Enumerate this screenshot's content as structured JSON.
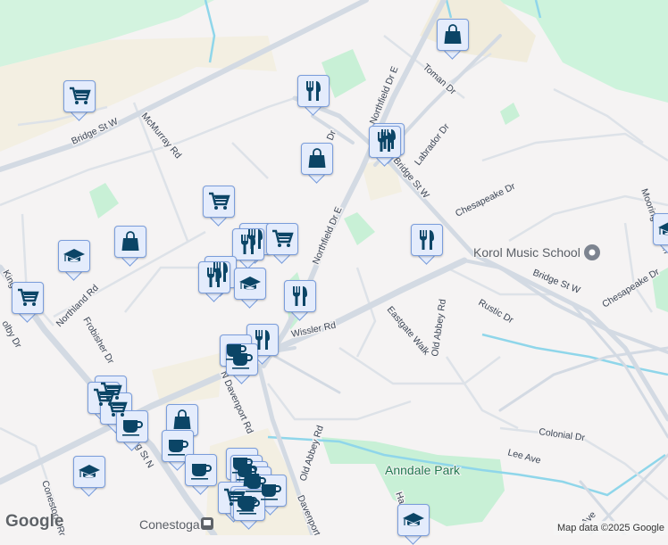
{
  "map": {
    "roads": {
      "bridge_st_w_west": "Bridge St W",
      "bridge_st_w_north": "Bridge St W",
      "bridge_st_w_east": "Bridge St W",
      "northfield_dr_e_north": "Northfield Dr E",
      "northfield_dr_e_south": "Northfield Dr E",
      "toman_dr": "Toman Dr",
      "labrador_dr": "Labrador Dr",
      "chesapeake_dr_north": "Chesapeake Dr",
      "chesapeake_dr_east": "Chesapeake Dr",
      "mooring_post_ln": "Mooring Post Ln",
      "mcmurray_rd": "McMurray Rd",
      "northland_rd": "Northland Rd",
      "frobisher_dr": "Frobisher Dr",
      "king_st_n_north": "King",
      "king_st_n_south": "g St N",
      "colby_dr": "olby Dr",
      "wissler_rd": "Wissler Rd",
      "eastgate_walk": "Eastgate Walk",
      "old_abbey_rd_north": "Old Abbey Rd",
      "old_abbey_rd_south": "Old Abbey Rd",
      "rustic_dr": "Rustic Dr",
      "n_davenport_rd": "N Davenport Rd",
      "davenport_rd": "Davenport",
      "colonial_dr": "Colonial Dr",
      "lee_ave": "Lee Ave",
      "conestogo_rd": "Conestogo Rd",
      "dr_fragment": "Dr",
      "ave_fragment": "Ave",
      "ha_fragment": "Ha"
    },
    "places": {
      "anndale_park": "Anndale Park",
      "korol_music_school": "Korol Music School",
      "conestoga": "Conestoga"
    },
    "markers": [
      {
        "type": "shopping",
        "icon": "shopping-bag-icon"
      },
      {
        "type": "grocery",
        "icon": "shopping-cart-icon"
      },
      {
        "type": "restaurant",
        "icon": "fork-knife-icon"
      },
      {
        "type": "cafe",
        "icon": "coffee-cup-icon"
      },
      {
        "type": "school",
        "icon": "graduation-cap-icon"
      }
    ],
    "colors": {
      "marker_icon": "#0b4566",
      "marker_bg": "#e4ecfc",
      "park": "#c8f0d6",
      "road": "#d5dce4",
      "water": "#8fd6ea"
    }
  },
  "footer": {
    "logo": "Google",
    "attribution": "Map data ©2025 Google"
  }
}
